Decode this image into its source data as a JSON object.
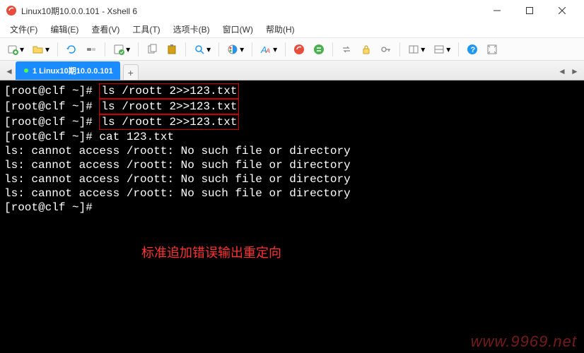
{
  "window": {
    "title": "Linux10期10.0.0.101 - Xshell 6"
  },
  "menu": {
    "file": "文件(F)",
    "edit": "编辑(E)",
    "view": "查看(V)",
    "tools": "工具(T)",
    "tabs": "选项卡(B)",
    "window": "窗口(W)",
    "help": "帮助(H)"
  },
  "tabs": {
    "active": {
      "label": "1 Linux10期10.0.0.101"
    },
    "add": "+"
  },
  "terminal": {
    "lines": [
      {
        "prompt": "[root@clf ~]# ",
        "cmd": "ls /roott 2>>123.txt",
        "boxed": true
      },
      {
        "prompt": "[root@clf ~]# ",
        "cmd": "ls /roott 2>>123.txt",
        "boxed": true
      },
      {
        "prompt": "[root@clf ~]# ",
        "cmd": "ls /roott 2>>123.txt",
        "boxed": true
      },
      {
        "prompt": "[root@clf ~]# ",
        "cmd": "cat 123.txt",
        "boxed": false
      },
      {
        "text": "ls: cannot access /roott: No such file or directory"
      },
      {
        "text": "ls: cannot access /roott: No such file or directory"
      },
      {
        "text": "ls: cannot access /roott: No such file or directory"
      },
      {
        "text": "ls: cannot access /roott: No such file or directory"
      },
      {
        "prompt": "[root@clf ~]# ",
        "cmd": "",
        "boxed": false
      }
    ],
    "annotation": "标准追加错误输出重定向",
    "watermark": "www.9969.net"
  },
  "colors": {
    "tab_active_bg": "#1a8cff",
    "terminal_bg": "#000000",
    "terminal_fg": "#ffffff",
    "highlight_border": "#cc0000",
    "annotation_fg": "#ff3333"
  }
}
